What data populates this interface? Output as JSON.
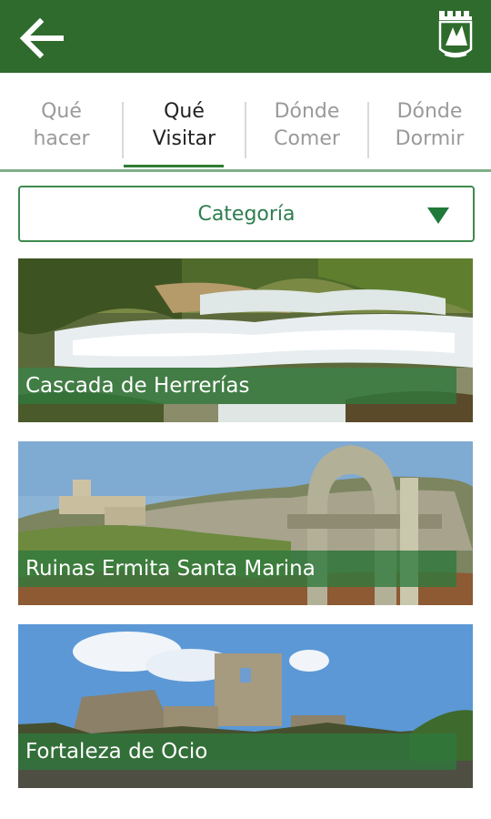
{
  "appbar": {
    "back_icon": "arrow-left-icon",
    "logo_icon": "municipal-crest-icon",
    "color": "#2e6b2c"
  },
  "tabs": [
    {
      "line1": "Qué",
      "line2": "hacer",
      "active": false
    },
    {
      "line1": "Qué",
      "line2": "Visitar",
      "active": true
    },
    {
      "line1": "Dónde",
      "line2": "Comer",
      "active": false
    },
    {
      "line1": "Dónde",
      "line2": "Dormir",
      "active": false
    }
  ],
  "category": {
    "label": "Categoría",
    "icon": "triangle-down-icon"
  },
  "places": [
    {
      "title": "Cascada de Herrerías"
    },
    {
      "title": "Ruinas Ermita Santa Marina"
    },
    {
      "title": "Fortaleza de Ocio"
    }
  ]
}
